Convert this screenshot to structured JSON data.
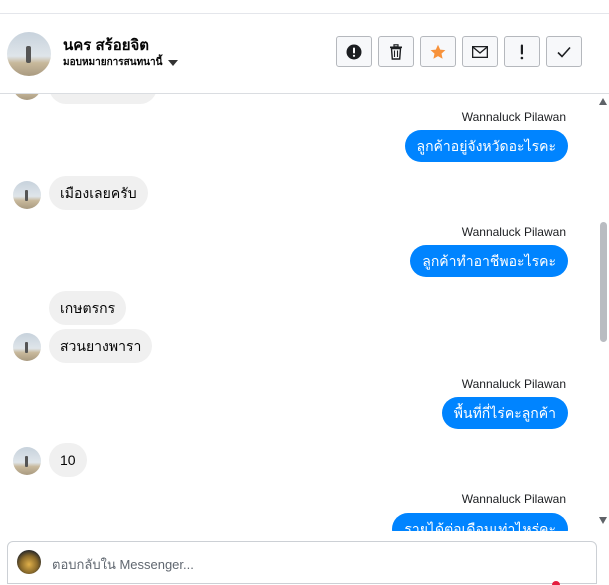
{
  "header": {
    "contact_name": "นคร สร้อยจิต",
    "status_label": "มอบหมายการสนทนานี้",
    "actions": [
      {
        "name": "mark-spam",
        "icon": "exclamation-circle-icon"
      },
      {
        "name": "delete",
        "icon": "trash-icon"
      },
      {
        "name": "star",
        "icon": "star-icon"
      },
      {
        "name": "mark-unread",
        "icon": "envelope-icon"
      },
      {
        "name": "important",
        "icon": "exclamation-icon"
      },
      {
        "name": "done",
        "icon": "checkmark-icon"
      }
    ],
    "colors": {
      "star": "#f7923b"
    }
  },
  "thread": {
    "messages": [
      {
        "direction": "out",
        "sender": "Wannaluck Pilawan",
        "text": "ลูกค้าอยู่จังหวัดอะไรคะ"
      },
      {
        "direction": "in",
        "text": "เมืองเลยครับ"
      },
      {
        "direction": "out",
        "sender": "Wannaluck Pilawan",
        "text": "ลูกค้าทำอาชีพอะไรคะ"
      },
      {
        "direction": "in",
        "text": "เกษตรกร"
      },
      {
        "direction": "in",
        "text": "สวนยางพารา"
      },
      {
        "direction": "out",
        "sender": "Wannaluck Pilawan",
        "text": "พื้นที่กี่ไร่คะลูกค้า"
      },
      {
        "direction": "in",
        "text": "10"
      },
      {
        "direction": "out",
        "sender": "Wannaluck Pilawan",
        "text": "รายได้ต่อเดือนเท่าไหร่คะ"
      }
    ],
    "colors": {
      "outgoing": "#0084ff",
      "incoming": "#f0f0f0"
    }
  },
  "composer": {
    "placeholder": "ตอบกลับใน Messenger..."
  }
}
